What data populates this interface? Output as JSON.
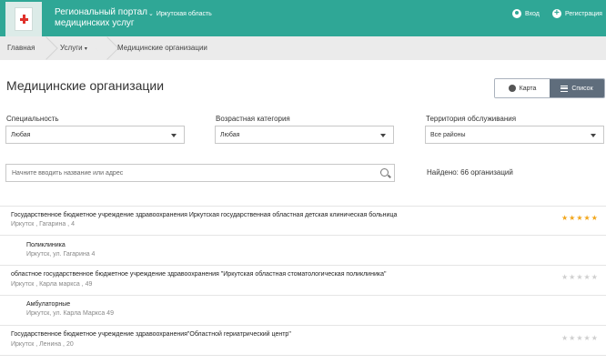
{
  "header": {
    "title": "Региональный портал медицинских услуг",
    "region": "Иркутская область",
    "login": "Вход",
    "register": "Регистрация"
  },
  "breadcrumb": [
    "Главная",
    "Услуги",
    "Медицинские организации"
  ],
  "page": {
    "title": "Медицинские организации",
    "view_map": "Карта",
    "view_list": "Список"
  },
  "filters": {
    "specialty_label": "Специальность",
    "specialty_value": "Любая",
    "age_label": "Возрастная категория",
    "age_value": "Любая",
    "territory_label": "Территория обслуживания",
    "territory_value": "Все районы"
  },
  "search": {
    "placeholder": "Начните вводить название или адрес",
    "found": "Найдено: 66 организаций"
  },
  "orgs": [
    {
      "name": "Государственное бюджетное учреждение здравоохранения Иркутская государственная областная детская клиническая больница",
      "address": "Иркутск , Гагарина , 4",
      "rating": 5,
      "sub": {
        "name": "Поликлиника",
        "address": "Иркутск, ул. Гагарина 4"
      }
    },
    {
      "name": "областное государственное бюджетное учреждение здравоохранения \"Иркутская областная стоматологическая поликлиника\"",
      "address": "Иркутск , Карла маркса , 49",
      "rating": 0,
      "sub": {
        "name": "Амбулаторные",
        "address": "Иркутск, ул. Карла Маркса 49"
      }
    },
    {
      "name": "Государственное бюджетное учреждение здравоохранения\"Областной гериатрический центр\"",
      "address": "Иркутск , Ленина , 20",
      "rating": 0
    }
  ],
  "colors": {
    "header": "#2fa796",
    "star_on": "#f2a61b",
    "star_off": "#cfcfcf",
    "list_button": "#5f6d7c"
  }
}
